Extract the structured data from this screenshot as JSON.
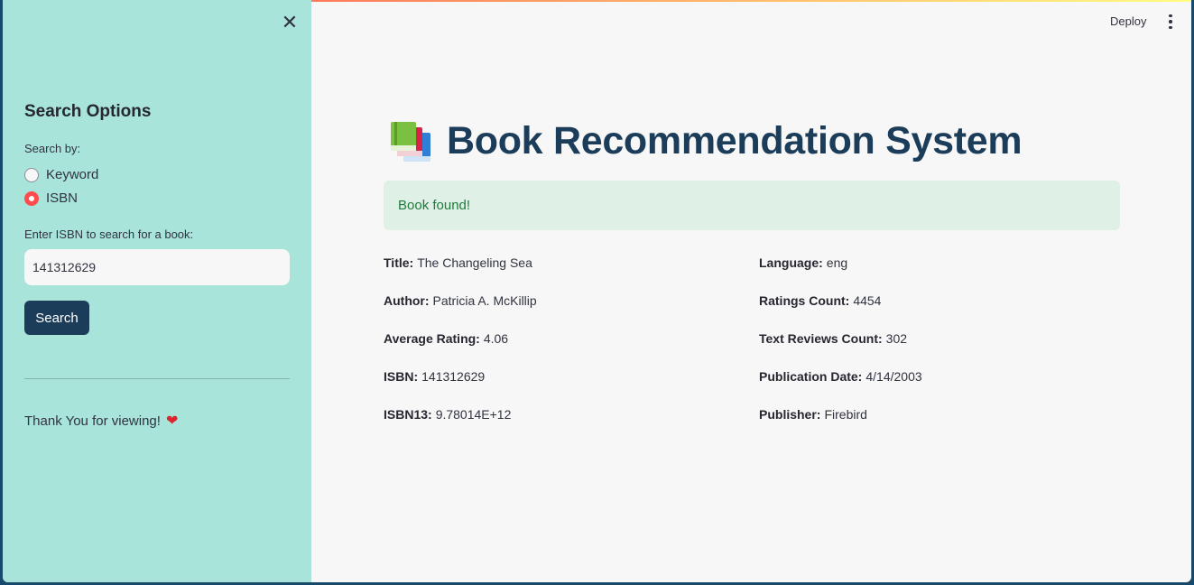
{
  "sidebar": {
    "title": "Search Options",
    "search_by_label": "Search by:",
    "radio_options": [
      "Keyword",
      "ISBN"
    ],
    "selected_option": "ISBN",
    "input_label": "Enter ISBN to search for a book:",
    "input_value": "141312629",
    "search_button": "Search",
    "thank_you": "Thank You for viewing!",
    "heart_icon": "red-heart-icon"
  },
  "header": {
    "deploy_label": "Deploy",
    "menu_icon": "vertical-dots-icon"
  },
  "main": {
    "title_icon": "books-icon",
    "title": "Book Recommendation System",
    "alert_text": "Book found!",
    "left_fields": [
      {
        "label": "Title:",
        "value": "The Changeling Sea"
      },
      {
        "label": "Author:",
        "value": "Patricia A. McKillip"
      },
      {
        "label": "Average Rating:",
        "value": "4.06"
      },
      {
        "label": "ISBN:",
        "value": "141312629"
      },
      {
        "label": "ISBN13:",
        "value": "9.78014E+12"
      }
    ],
    "right_fields": [
      {
        "label": "Language:",
        "value": "eng"
      },
      {
        "label": "Ratings Count:",
        "value": "4454"
      },
      {
        "label": "Text Reviews Count:",
        "value": "302"
      },
      {
        "label": "Publication Date:",
        "value": "4/14/2003"
      },
      {
        "label": "Publisher:",
        "value": "Firebird"
      }
    ]
  },
  "colors": {
    "sidebar_bg": "#a8e4da",
    "main_bg": "#f7f7f7",
    "title_color": "#1c3d5a",
    "button_bg": "#1c3d5a",
    "radio_selected": "#ff4b4b",
    "alert_bg": "#dff0e6",
    "alert_text": "#217a3c"
  }
}
